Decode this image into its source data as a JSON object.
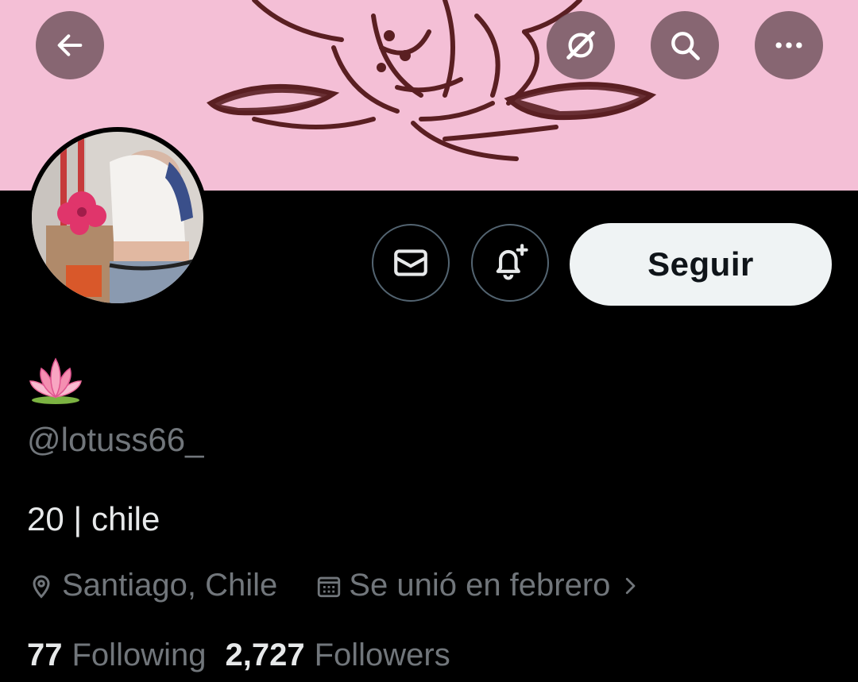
{
  "header": {
    "back_icon": "arrow-left-icon",
    "grok_icon": "grok-icon",
    "search_icon": "search-icon",
    "more_icon": "more-dots-icon",
    "banner_color": "#f4bfd6"
  },
  "profile": {
    "display_name": "🪷",
    "handle": "@lotuss66_",
    "bio": "20 | chile",
    "location": "Santiago, Chile",
    "joined": "Se unió en febrero",
    "following_count": "77",
    "following_label": "Following",
    "followers_count": "2,727",
    "followers_label": "Followers"
  },
  "actions": {
    "message_icon": "envelope-icon",
    "notify_icon": "bell-plus-icon",
    "follow_label": "Seguir"
  },
  "colors": {
    "background": "#000000",
    "muted_text": "#71767b",
    "primary_text": "#e7e9ea",
    "button_bg": "#eff3f4"
  }
}
